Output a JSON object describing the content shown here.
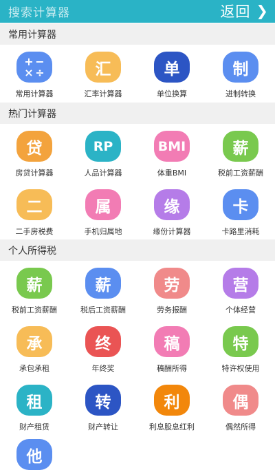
{
  "header": {
    "search_placeholder": "搜索计算器",
    "back_label": "返回"
  },
  "sections": [
    {
      "title": "常用计算器",
      "items": [
        {
          "glyph": "",
          "label": "常用计算器",
          "color": "#5b8ef0"
        },
        {
          "glyph": "汇",
          "label": "汇率计算器",
          "color": "#f7bc57"
        },
        {
          "glyph": "单",
          "label": "单位换算",
          "color": "#2c55c4"
        },
        {
          "glyph": "制",
          "label": "进制转换",
          "color": "#5b8ef0"
        }
      ]
    },
    {
      "title": "热门计算器",
      "items": [
        {
          "glyph": "贷",
          "label": "房贷计算器",
          "color": "#f3a33d"
        },
        {
          "glyph": "RP",
          "label": "人品计算器",
          "color": "#2bb3c6"
        },
        {
          "glyph": "BMI",
          "label": "体重BMI",
          "color": "#f27cb4"
        },
        {
          "glyph": "薪",
          "label": "税前工资薪酬",
          "color": "#79c94e"
        },
        {
          "glyph": "二",
          "label": "二手房税费",
          "color": "#f7bc57"
        },
        {
          "glyph": "属",
          "label": "手机归属地",
          "color": "#f27cb4"
        },
        {
          "glyph": "缘",
          "label": "缘份计算器",
          "color": "#b57ce8"
        },
        {
          "glyph": "卡",
          "label": "卡路里消耗",
          "color": "#5b8ef0"
        }
      ]
    },
    {
      "title": "个人所得税",
      "items": [
        {
          "glyph": "薪",
          "label": "税前工资薪酬",
          "color": "#79c94e"
        },
        {
          "glyph": "薪",
          "label": "税后工资薪酬",
          "color": "#5b8ef0"
        },
        {
          "glyph": "劳",
          "label": "劳务报酬",
          "color": "#f08a8a"
        },
        {
          "glyph": "营",
          "label": "个体经营",
          "color": "#b57ce8"
        },
        {
          "glyph": "承",
          "label": "承包承租",
          "color": "#f7bc57"
        },
        {
          "glyph": "终",
          "label": "年终奖",
          "color": "#ea5454"
        },
        {
          "glyph": "稿",
          "label": "稿酬所得",
          "color": "#f27cb4"
        },
        {
          "glyph": "特",
          "label": "特许权使用",
          "color": "#79c94e"
        },
        {
          "glyph": "租",
          "label": "财产租赁",
          "color": "#2bb3c6"
        },
        {
          "glyph": "转",
          "label": "财产转让",
          "color": "#2c55c4"
        },
        {
          "glyph": "利",
          "label": "利息股息红利",
          "color": "#f2870b"
        },
        {
          "glyph": "偶",
          "label": "偶然所得",
          "color": "#f08a8a"
        }
      ]
    }
  ],
  "partial_item": {
    "glyph": "他"
  },
  "calc_symbols": [
    "+",
    "−",
    "×",
    "÷"
  ],
  "icon_names": {
    "back": "chevron-right-icon",
    "calculator": "calculator-icon"
  }
}
